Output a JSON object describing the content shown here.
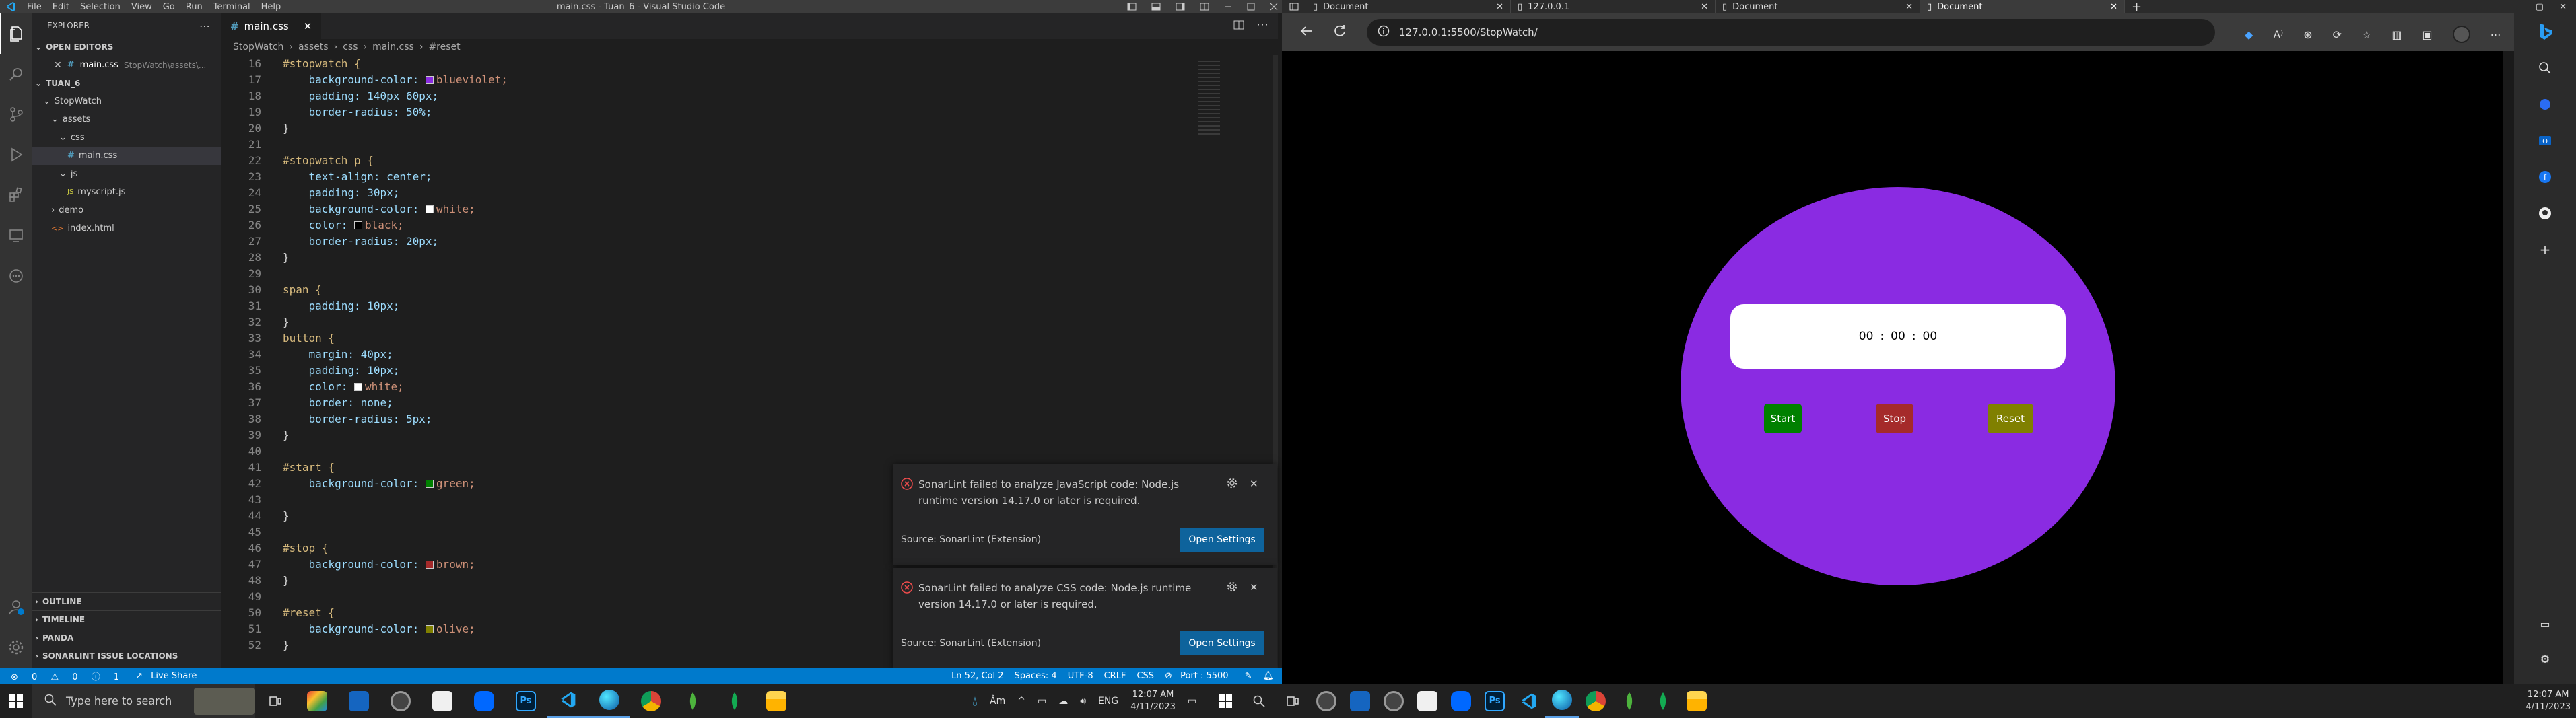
{
  "vscode": {
    "menu": [
      "File",
      "Edit",
      "Selection",
      "View",
      "Go",
      "Run",
      "Terminal",
      "Help"
    ],
    "window_title": "main.css - Tuan_6 - Visual Studio Code",
    "explorer": {
      "title": "EXPLORER",
      "open_editors": "OPEN EDITORS",
      "open_file": "main.css",
      "open_file_path": "StopWatch\\assets\\...",
      "workspace": "TUAN_6",
      "tree": [
        {
          "label": "StopWatch",
          "depth": 1,
          "kind": "folder"
        },
        {
          "label": "assets",
          "depth": 2,
          "kind": "folder"
        },
        {
          "label": "css",
          "depth": 3,
          "kind": "folder"
        },
        {
          "label": "main.css",
          "depth": 4,
          "kind": "css",
          "selected": true
        },
        {
          "label": "js",
          "depth": 3,
          "kind": "folder"
        },
        {
          "label": "myscript.js",
          "depth": 4,
          "kind": "js"
        },
        {
          "label": "demo",
          "depth": 2,
          "kind": "folder-collapsed"
        },
        {
          "label": "index.html",
          "depth": 2,
          "kind": "html"
        }
      ],
      "panels": [
        "OUTLINE",
        "TIMELINE",
        "PANDA",
        "SONARLINT ISSUE LOCATIONS"
      ]
    },
    "tab": "main.css",
    "breadcrumbs": [
      "StopWatch",
      "assets",
      "css",
      "main.css",
      "#reset"
    ],
    "code": [
      {
        "n": "16",
        "t": "#stopwatch {"
      },
      {
        "n": "17",
        "t": "    background-color: ",
        "sw": "#8a2be2",
        "v": "blueviolet;"
      },
      {
        "n": "18",
        "t": "    padding: 140px 60px;"
      },
      {
        "n": "19",
        "t": "    border-radius: 50%;"
      },
      {
        "n": "20",
        "t": "}"
      },
      {
        "n": "21",
        "t": ""
      },
      {
        "n": "22",
        "t": "#stopwatch p {"
      },
      {
        "n": "23",
        "t": "    text-align: center;"
      },
      {
        "n": "24",
        "t": "    padding: 30px;"
      },
      {
        "n": "25",
        "t": "    background-color: ",
        "sw": "#ffffff",
        "v": "white;"
      },
      {
        "n": "26",
        "t": "    color: ",
        "sw": "#000000",
        "v": "black;"
      },
      {
        "n": "27",
        "t": "    border-radius: 20px;"
      },
      {
        "n": "28",
        "t": "}"
      },
      {
        "n": "29",
        "t": ""
      },
      {
        "n": "30",
        "t": "span {"
      },
      {
        "n": "31",
        "t": "    padding: 10px;"
      },
      {
        "n": "32",
        "t": "}"
      },
      {
        "n": "33",
        "t": "button {"
      },
      {
        "n": "34",
        "t": "    margin: 40px;"
      },
      {
        "n": "35",
        "t": "    padding: 10px;"
      },
      {
        "n": "36",
        "t": "    color: ",
        "sw": "#ffffff",
        "v": "white;"
      },
      {
        "n": "37",
        "t": "    border: none;"
      },
      {
        "n": "38",
        "t": "    border-radius: 5px;"
      },
      {
        "n": "39",
        "t": "}"
      },
      {
        "n": "40",
        "t": ""
      },
      {
        "n": "41",
        "t": "#start {"
      },
      {
        "n": "42",
        "t": "    background-color: ",
        "sw": "#008000",
        "v": "green;"
      },
      {
        "n": "43",
        "t": ""
      },
      {
        "n": "44",
        "t": "}"
      },
      {
        "n": "45",
        "t": ""
      },
      {
        "n": "46",
        "t": "#stop {"
      },
      {
        "n": "47",
        "t": "    background-color: ",
        "sw": "#a52a2a",
        "v": "brown;"
      },
      {
        "n": "48",
        "t": "}"
      },
      {
        "n": "49",
        "t": ""
      },
      {
        "n": "50",
        "t": "#reset {"
      },
      {
        "n": "51",
        "t": "    background-color: ",
        "sw": "#808000",
        "v": "olive;"
      },
      {
        "n": "52",
        "t": "}"
      }
    ],
    "notifications": [
      {
        "message": "SonarLint failed to analyze JavaScript code: Node.js runtime version 14.17.0 or later is required.",
        "source": "Source: SonarLint (Extension)",
        "button": "Open Settings"
      },
      {
        "message": "SonarLint failed to analyze CSS code: Node.js runtime version 14.17.0 or later is required.",
        "source": "Source: SonarLint (Extension)",
        "button": "Open Settings"
      }
    ],
    "status": {
      "errors": "0",
      "warnings": "0",
      "info": "1",
      "live_share": "Live Share",
      "position": "Ln 52, Col 2",
      "spaces": "Spaces: 4",
      "encoding": "UTF-8",
      "eol": "CRLF",
      "language": "CSS",
      "port": "Port : 5500"
    }
  },
  "browser": {
    "tabs": [
      {
        "title": "Document",
        "active": false
      },
      {
        "title": "127.0.0.1",
        "active": false
      },
      {
        "title": "Document",
        "active": false
      },
      {
        "title": "Document",
        "active": true
      }
    ],
    "url": "127.0.0.1:5500/StopWatch/",
    "stopwatch": {
      "time": [
        "00",
        "00",
        "00"
      ],
      "separator": ":",
      "buttons": [
        {
          "label": "Start",
          "color": "#008000"
        },
        {
          "label": "Stop",
          "color": "#a52a2a"
        },
        {
          "label": "Reset",
          "color": "#808000"
        }
      ]
    }
  },
  "taskbar": {
    "search_placeholder": "Type here to search",
    "weather": "Âm",
    "lang": "ENG",
    "time": "12:07 AM",
    "date": "4/11/2023",
    "time2": "12:07 AM",
    "date2": "4/11/2023"
  }
}
